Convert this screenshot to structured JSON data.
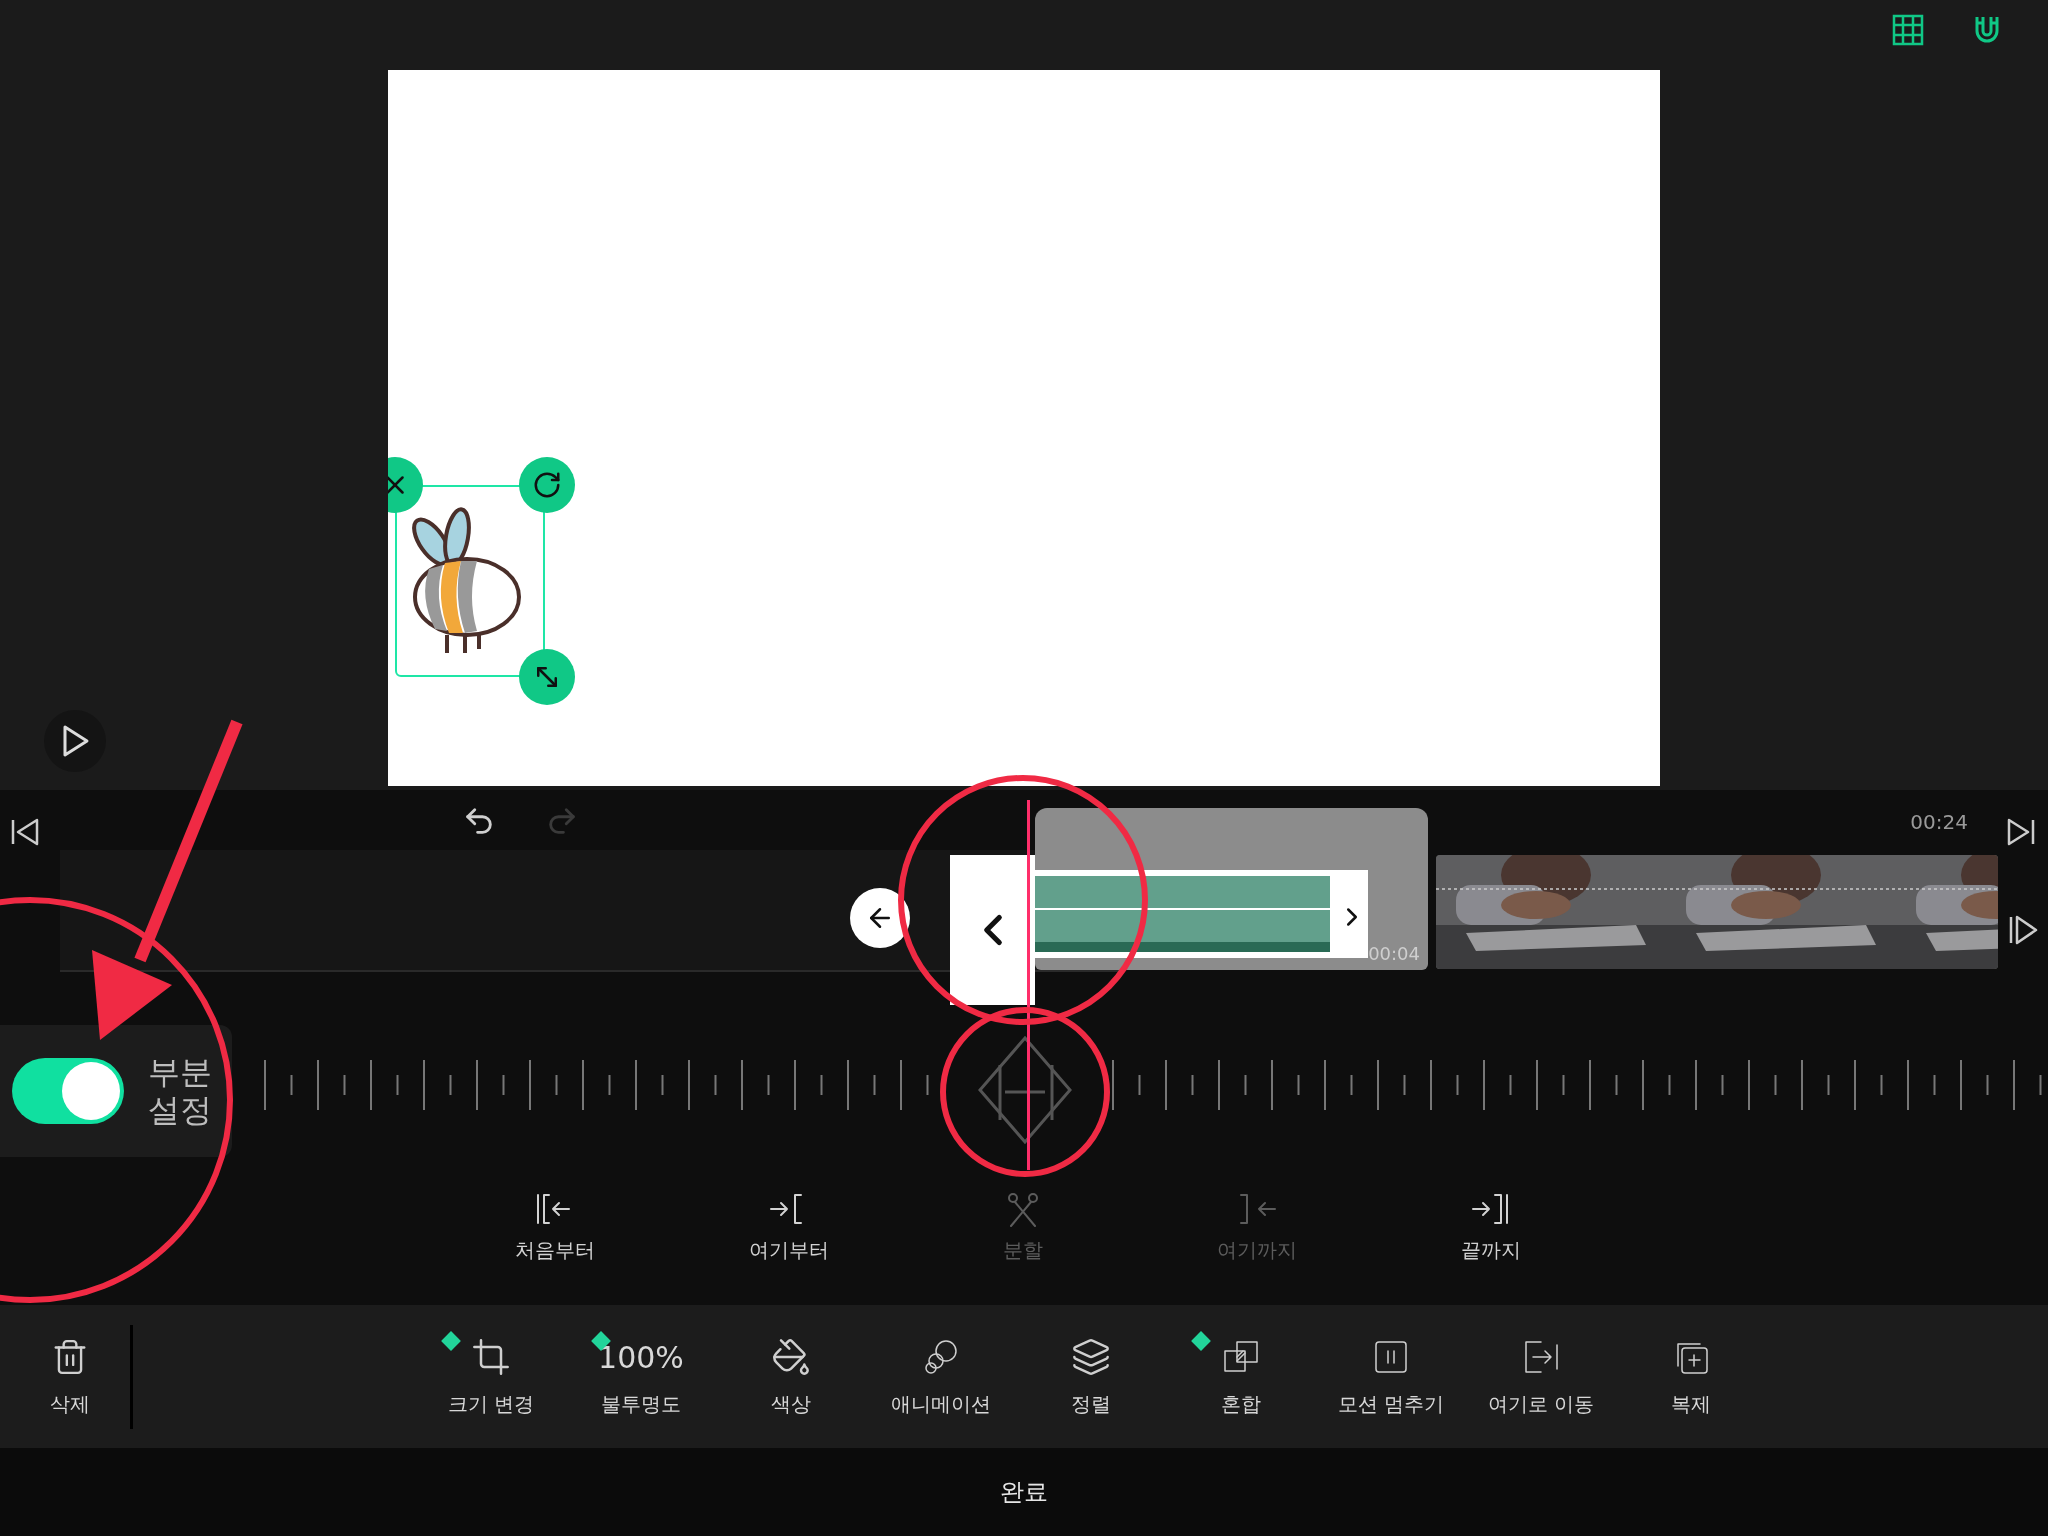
{
  "timeline": {
    "undo": {
      "disabled": false
    },
    "redo": {
      "disabled": true
    },
    "duration": "00:24",
    "clip_duration": "00:04",
    "partial_toggle": {
      "label": "부분 설정",
      "on": true
    }
  },
  "split_actions": [
    {
      "label": "처음부터",
      "disabled": false
    },
    {
      "label": "여기부터",
      "disabled": false
    },
    {
      "label": "분할",
      "disabled": true
    },
    {
      "label": "여기까지",
      "disabled": true
    },
    {
      "label": "끝까지",
      "disabled": false
    }
  ],
  "delete": {
    "label": "삭제"
  },
  "tools": [
    {
      "label": "크기 변경",
      "keyframe": true
    },
    {
      "label": "불투명도",
      "value": "100%",
      "keyframe": true
    },
    {
      "label": "색상",
      "keyframe": false
    },
    {
      "label": "애니메이션",
      "keyframe": false
    },
    {
      "label": "정렬",
      "keyframe": false
    },
    {
      "label": "혼합",
      "keyframe": true
    },
    {
      "label": "모션 멈추기",
      "keyframe": false
    },
    {
      "label": "여기로 이동",
      "keyframe": false
    },
    {
      "label": "복제",
      "keyframe": false
    }
  ],
  "done": {
    "label": "완료"
  }
}
